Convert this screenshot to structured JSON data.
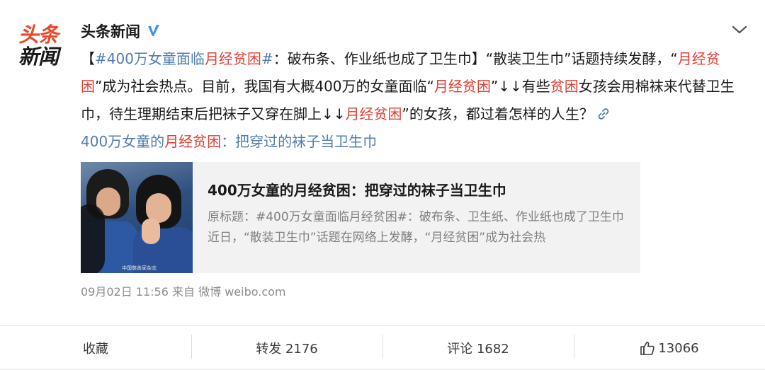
{
  "account": {
    "avatar_line1": "头条",
    "avatar_line2": "新闻",
    "name": "头条新闻",
    "verified_icon": "v-badge-icon",
    "menu_icon": "chevron-down-icon"
  },
  "post": {
    "segments": [
      {
        "text": "【",
        "style": "plain"
      },
      {
        "text": "#400万女童面临",
        "style": "link"
      },
      {
        "text": "月经贫困",
        "style": "hl"
      },
      {
        "text": "#",
        "style": "link"
      },
      {
        "text": "：破布条、作业纸也成了卫生巾】“散装卫生巾”话题持续发酵，“",
        "style": "plain"
      },
      {
        "text": "月经贫困",
        "style": "hl"
      },
      {
        "text": "”成为社会热点。目前，我国有大概400万的女童面临“",
        "style": "plain"
      },
      {
        "text": "月经贫困",
        "style": "hl"
      },
      {
        "text": "”↓↓有些",
        "style": "plain"
      },
      {
        "text": "贫困",
        "style": "hl"
      },
      {
        "text": "女孩会用棉袜来代替卫生巾，待生理期结束后把袜子又穿在脚上↓↓",
        "style": "plain"
      },
      {
        "text": "月经贫困",
        "style": "hl"
      },
      {
        "text": "”的女孩，都过着怎样的人生？",
        "style": "plain"
      }
    ],
    "link_icon": "link-icon",
    "article_link_pre": "400万女童的",
    "article_link_hl": "月经贫困",
    "article_link_post": "：把穿过的袜子当卫生巾"
  },
  "card": {
    "title": "400万女童的月经贫困：把穿过的袜子当卫生巾",
    "summary": "原标题：#400万女童面临月经贫困#：破布条、卫生纸、作业纸也成了卫生巾 近日，“散装卫生巾”话题在网络上发酵，“月经贫困”成为社会热",
    "thumb_watermark": "中国慈善家杂志"
  },
  "meta": {
    "time": "09月02日 11:56",
    "source": "来自 微博 weibo.com"
  },
  "actions": {
    "favorite": "收藏",
    "repost": "转发 2176",
    "comment": "评论 1682",
    "like_count": "13066",
    "like_icon": "thumbs-up-icon"
  }
}
